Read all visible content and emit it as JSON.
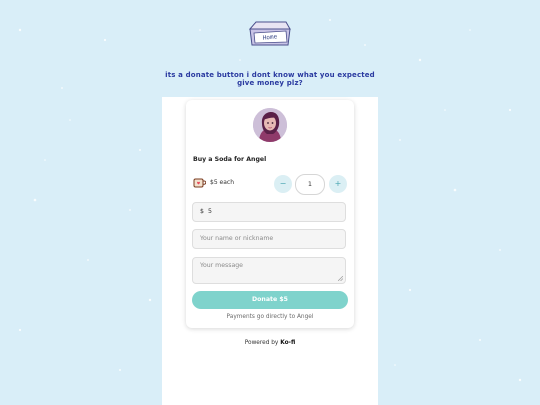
{
  "nav": {
    "home_label": "Home"
  },
  "tagline": {
    "line1": "its a donate button i dont know what you expected",
    "line2": "give money plz?"
  },
  "widget": {
    "title": "Buy a Soda for Angel",
    "price_each": "$5 each",
    "icon": "coffee-cup-icon",
    "quantity": "1",
    "minus_label": "−",
    "plus_label": "+",
    "currency_symbol": "$",
    "amount": "5",
    "name_placeholder": "Your name or nickname",
    "message_placeholder": "Your message",
    "donate_label": "Donate $5",
    "payments_note": "Payments go directly to Angel"
  },
  "footer": {
    "powered_by": "Powered by",
    "brand": "Ko-fi"
  },
  "colors": {
    "background": "#d9eef8",
    "accent_button": "#7fd3cc",
    "tagline": "#2a3aa0"
  }
}
